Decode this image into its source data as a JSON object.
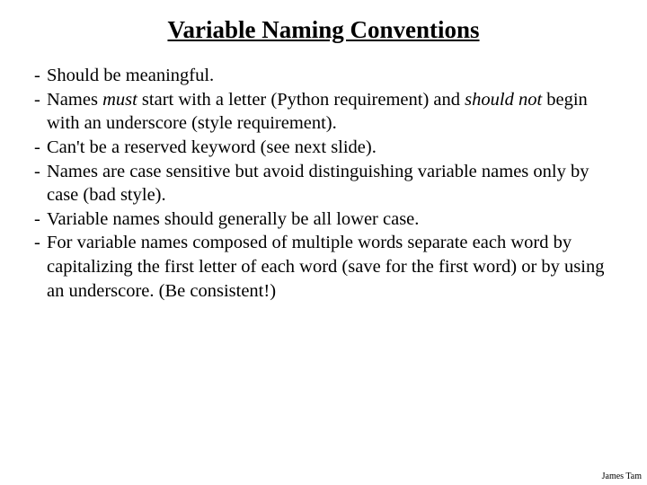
{
  "title": "Variable Naming Conventions",
  "bullets": {
    "b0": "Should be meaningful.",
    "b1_pre": "Names ",
    "b1_em1": "must",
    "b1_mid1": " start with a letter (Python requirement) and ",
    "b1_em2": "should not",
    "b1_post": " begin with an underscore (style requirement).",
    "b2": "Can't be a reserved keyword (see next slide).",
    "b3": "Names are case sensitive but avoid distinguishing variable names only by case (bad style).",
    "b4": "Variable names should generally be all lower case.",
    "b5": "For variable names composed of multiple words separate each word by capitalizing the first letter of each word (save for the first word) or by using an underscore. (Be consistent!)"
  },
  "footer": "James Tam"
}
